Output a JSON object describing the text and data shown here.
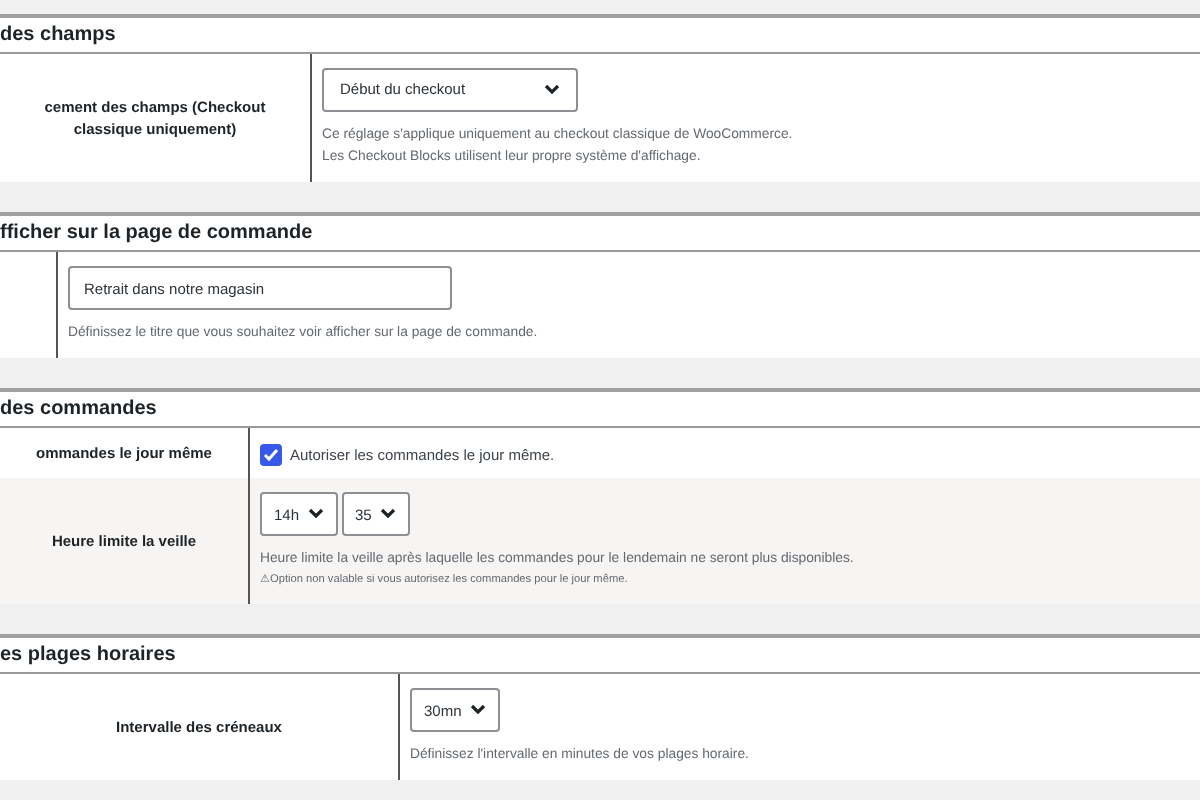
{
  "sections": [
    {
      "title": "des champs",
      "rows": [
        {
          "kind": "select",
          "label": "cement des champs (Checkout classique uniquement)",
          "selects": [
            "Début du checkout"
          ],
          "descriptions": [
            "Ce réglage s'applique uniquement au checkout classique de WooCommerce.",
            "Les Checkout Blocks utilisent leur propre système d'affichage."
          ]
        }
      ]
    },
    {
      "title": "fficher sur la page de commande",
      "rows": [
        {
          "kind": "text",
          "value": "Retrait dans notre magasin",
          "descriptions": [
            "Définissez le titre que vous souhaitez voir afficher sur la page de commande."
          ]
        }
      ]
    },
    {
      "title": "des commandes",
      "rows": [
        {
          "kind": "checkbox",
          "label": "ommandes le jour même",
          "checked": true,
          "checkbox_label": "Autoriser les commandes le jour même."
        },
        {
          "kind": "select",
          "label": "Heure limite la veille",
          "selects": [
            "14h",
            "35"
          ],
          "descriptions": [
            "Heure limite la veille après laquelle les commandes pour le lendemain ne seront plus disponibles."
          ],
          "note": "⚠Option non valable si vous autorisez les commandes pour le jour même."
        }
      ]
    },
    {
      "title": "es plages horaires",
      "rows": [
        {
          "kind": "select",
          "label": "Intervalle des créneaux",
          "selects": [
            "30mn"
          ],
          "descriptions": [
            "Définissez l'intervalle en minutes de vos plages horaire."
          ]
        }
      ]
    }
  ]
}
